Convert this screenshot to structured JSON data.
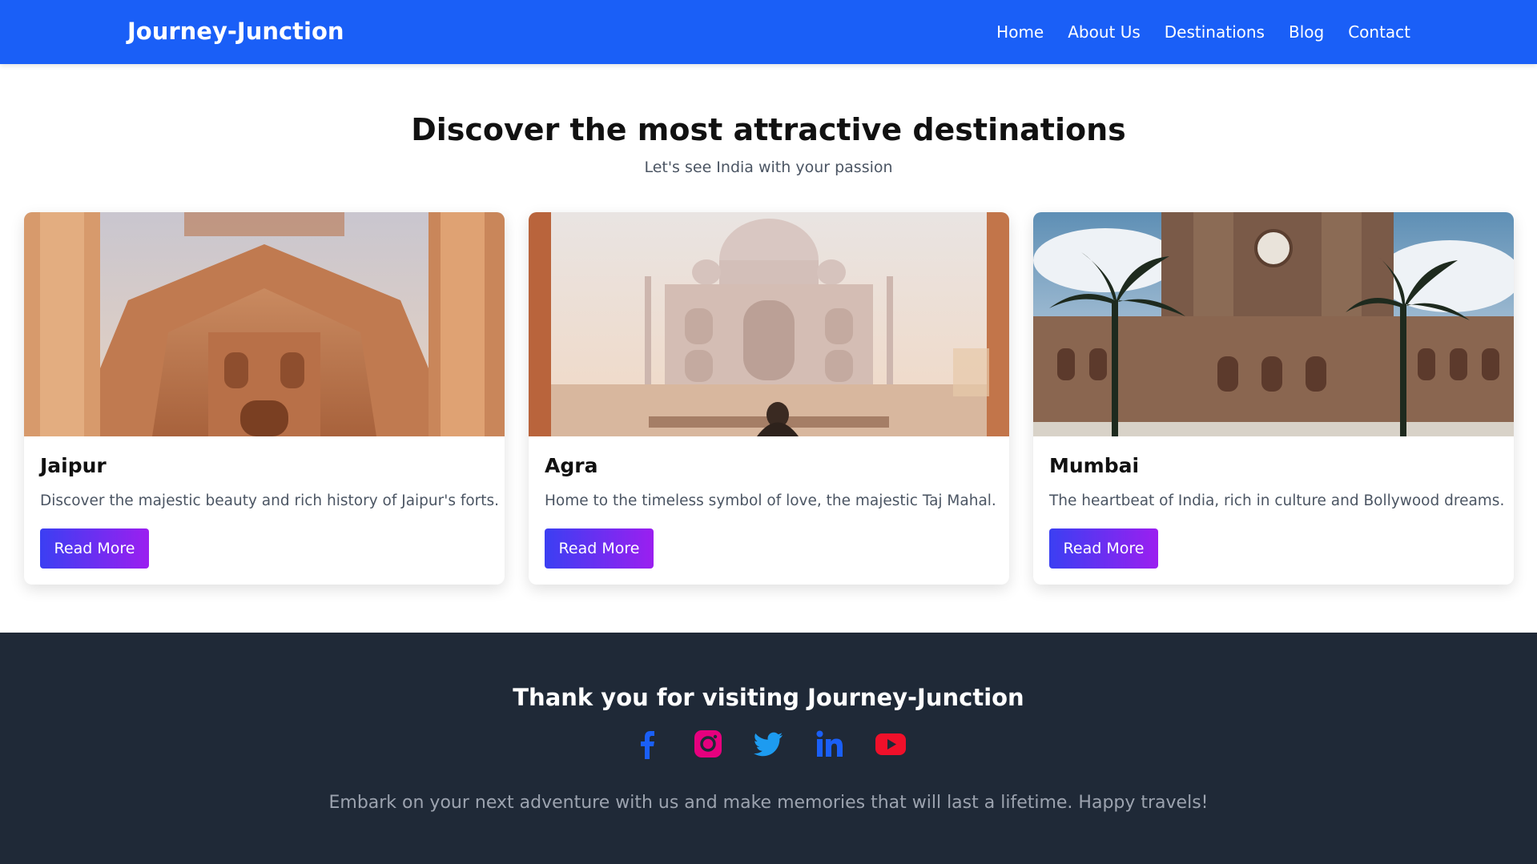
{
  "nav": {
    "brand": "Journey-Junction",
    "links": [
      "Home",
      "About Us",
      "Destinations",
      "Blog",
      "Contact"
    ]
  },
  "hero": {
    "title": "Discover the most attractive destinations",
    "subtitle": "Let's see India with your passion"
  },
  "cards": [
    {
      "title": "Jaipur",
      "description": "Discover the majestic beauty and rich history of Jaipur's forts.",
      "button": "Read More"
    },
    {
      "title": "Agra",
      "description": "Home to the timeless symbol of love, the majestic Taj Mahal.",
      "button": "Read More"
    },
    {
      "title": "Mumbai",
      "description": "The heartbeat of India, rich in culture and Bollywood dreams.",
      "button": "Read More"
    }
  ],
  "footer": {
    "title": "Thank you for visiting Journey-Junction",
    "text": "Embark on your next adventure with us and make memories that will last a lifetime. Happy travels!",
    "socials": [
      "facebook-icon",
      "instagram-icon",
      "twitter-icon",
      "linkedin-icon",
      "youtube-icon"
    ]
  },
  "colors": {
    "navbar": "#1a5ff7",
    "footer": "#1f2937",
    "button_gradient_start": "#3b3ff2",
    "button_gradient_end": "#9b1ff0"
  }
}
